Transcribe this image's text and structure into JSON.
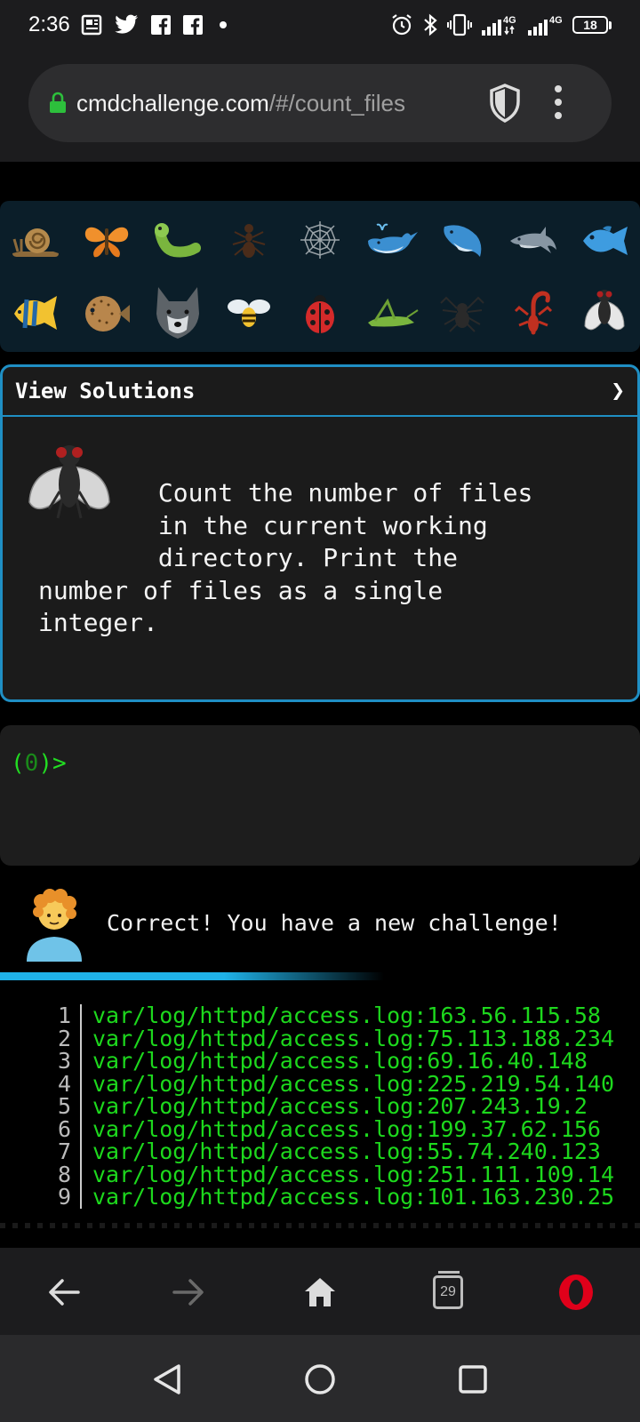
{
  "status_bar": {
    "time": "2:36",
    "battery": "18",
    "network_1": "4G",
    "network_2": "4G"
  },
  "browser": {
    "url_domain": "cmdchallenge.com",
    "url_path": "/#/count_files"
  },
  "emoji_grid": {
    "row1": [
      "snail-icon",
      "butterfly-icon",
      "bug-icon",
      "ant-icon",
      "spider-web-icon",
      "whale-icon",
      "spouting-whale-icon",
      "dolphin-icon",
      "fish-icon"
    ],
    "row2": [
      "tropical-fish-icon",
      "blowfish-icon",
      "wolf-icon",
      "bee-icon",
      "ladybug-icon",
      "cricket-icon",
      "spider-icon",
      "scorpion-icon",
      "fly-icon"
    ]
  },
  "solutions": {
    "header": "View Solutions",
    "chevron": "❯",
    "challenge_text": "        Count the number of files\n        in the current working\n        directory. Print the\nnumber of files as a single\ninteger."
  },
  "terminal": {
    "prompt_open": "(",
    "prompt_count": "0",
    "prompt_close": ")>"
  },
  "message": {
    "text": "Correct! You have a new challenge!"
  },
  "output": {
    "lines": [
      {
        "n": "1",
        "text": "var/log/httpd/access.log:163.56.115.58"
      },
      {
        "n": "2",
        "text": "var/log/httpd/access.log:75.113.188.234"
      },
      {
        "n": "3",
        "text": "var/log/httpd/access.log:69.16.40.148"
      },
      {
        "n": "4",
        "text": "var/log/httpd/access.log:225.219.54.140"
      },
      {
        "n": "5",
        "text": "var/log/httpd/access.log:207.243.19.2"
      },
      {
        "n": "6",
        "text": "var/log/httpd/access.log:199.37.62.156"
      },
      {
        "n": "7",
        "text": "var/log/httpd/access.log:55.74.240.123"
      },
      {
        "n": "8",
        "text": "var/log/httpd/access.log:251.111.109.14"
      },
      {
        "n": "9",
        "text": "var/log/httpd/access.log:101.163.230.25"
      }
    ]
  },
  "browser_nav": {
    "tab_count": "29"
  },
  "colors": {
    "accent": "#1f8fc4",
    "terminal_green": "#1dd81d",
    "opera_red": "#e0001a"
  }
}
